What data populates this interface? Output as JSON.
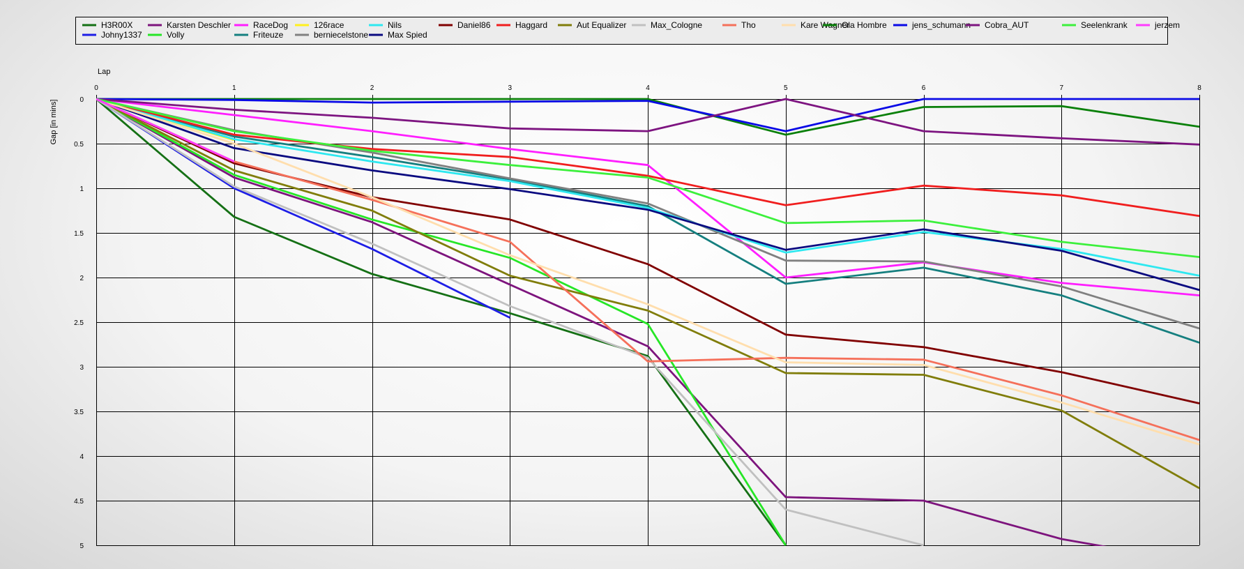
{
  "chart_data": {
    "type": "line",
    "xlabel": "Lap",
    "ylabel": "Gap [in mins]",
    "xlim": [
      0,
      8
    ],
    "ylim": [
      0,
      5
    ],
    "y_inverted": true,
    "grid": true,
    "legend_position": "top",
    "x_ticks": [
      "0",
      "1",
      "2",
      "3",
      "4",
      "5",
      "6",
      "7",
      "8"
    ],
    "y_ticks": [
      "0",
      "0.5",
      "1",
      "1.5",
      "2",
      "2.5",
      "3",
      "3.5",
      "4",
      "4.5",
      "5"
    ],
    "series": [
      {
        "name": "H3R00X",
        "color": "#157015",
        "x": [
          0,
          1,
          2,
          3,
          4,
          5
        ],
        "values": [
          0,
          1.32,
          1.96,
          2.4,
          2.88,
          5.0
        ]
      },
      {
        "name": "Johny1337",
        "color": "#1E1EE6",
        "x": [
          0,
          1,
          2,
          3
        ],
        "values": [
          0,
          1.0,
          1.68,
          2.45
        ]
      },
      {
        "name": "Karsten Deschler",
        "color": "#7D147D",
        "x": [
          0,
          1,
          2,
          3,
          4,
          5,
          6,
          7,
          8
        ],
        "values": [
          0,
          0.88,
          1.38,
          2.08,
          2.77,
          4.46,
          4.5,
          4.93,
          5.2
        ]
      },
      {
        "name": "Volly",
        "color": "#26E626",
        "x": [
          0,
          1,
          2,
          3,
          4,
          5
        ],
        "values": [
          0,
          0.85,
          1.35,
          1.78,
          2.52,
          5.0
        ]
      },
      {
        "name": "RaceDog",
        "color": "#FF1EFF",
        "x": [
          0,
          1,
          2,
          3,
          4,
          5,
          6,
          7,
          8
        ],
        "values": [
          0,
          0.18,
          0.36,
          0.56,
          0.74,
          2.0,
          1.83,
          2.06,
          2.2
        ]
      },
      {
        "name": "Friteuze",
        "color": "#157F7F",
        "x": [
          0,
          1,
          2,
          3,
          4,
          5,
          6,
          7,
          8
        ],
        "values": [
          0,
          0.42,
          0.65,
          0.9,
          1.2,
          2.07,
          1.89,
          2.2,
          2.73
        ]
      },
      {
        "name": "126race",
        "color": "#FFF01E",
        "x": [
          0,
          1
        ],
        "values": [
          0,
          0.46
        ]
      },
      {
        "name": "berniecelstone",
        "color": "#808080",
        "x": [
          0,
          1,
          2,
          3,
          4,
          5,
          6,
          7,
          8
        ],
        "values": [
          0,
          0.35,
          0.6,
          0.89,
          1.17,
          1.81,
          1.82,
          2.1,
          2.57
        ]
      },
      {
        "name": "Nils",
        "color": "#2EE8F0",
        "x": [
          0,
          1,
          2,
          3,
          4,
          5,
          6,
          7,
          8
        ],
        "values": [
          0,
          0.45,
          0.7,
          0.92,
          1.22,
          1.72,
          1.49,
          1.68,
          1.98
        ]
      },
      {
        "name": "Max Spied",
        "color": "#0A0A80",
        "x": [
          0,
          1,
          2,
          3,
          4,
          5,
          6,
          7,
          8
        ],
        "values": [
          0,
          0.55,
          0.8,
          1.01,
          1.24,
          1.69,
          1.46,
          1.7,
          2.14
        ]
      },
      {
        "name": "Daniel86",
        "color": "#800000",
        "x": [
          0,
          1,
          2,
          3,
          4,
          5,
          6,
          7,
          8
        ],
        "values": [
          0,
          0.72,
          1.1,
          1.35,
          1.85,
          2.64,
          2.78,
          3.06,
          3.41
        ]
      },
      {
        "name": "Haggard",
        "color": "#F01E1E",
        "x": [
          0,
          1,
          2,
          3,
          4,
          5,
          6,
          7,
          8
        ],
        "values": [
          0,
          0.4,
          0.56,
          0.65,
          0.86,
          1.19,
          0.97,
          1.08,
          1.31
        ]
      },
      {
        "name": "Aut Equalizer",
        "color": "#807D0A",
        "x": [
          0,
          1,
          2,
          3,
          4,
          5,
          6,
          7,
          8
        ],
        "values": [
          0,
          0.8,
          1.25,
          1.98,
          2.37,
          3.07,
          3.09,
          3.49,
          4.36
        ]
      },
      {
        "name": "Max_Cologne",
        "color": "#C0C0C0",
        "x": [
          0,
          1,
          2,
          3,
          4,
          5,
          6
        ],
        "values": [
          0,
          0.98,
          1.62,
          2.32,
          2.9,
          4.6,
          5.0
        ]
      },
      {
        "name": "Tho",
        "color": "#F5705A",
        "x": [
          0,
          1,
          2,
          3,
          4,
          5,
          6,
          7,
          8
        ],
        "values": [
          0,
          0.7,
          1.13,
          1.6,
          2.94,
          2.9,
          2.92,
          3.32,
          3.82
        ]
      },
      {
        "name": "Kare Wagner",
        "color": "#FFDEAD",
        "x": [
          0,
          1,
          2,
          3,
          4,
          5,
          6,
          7,
          8
        ],
        "values": [
          0,
          0.5,
          1.1,
          1.75,
          2.3,
          2.95,
          2.98,
          3.4,
          3.87
        ]
      },
      {
        "name": "Ola Hombre",
        "color": "#0A800A",
        "x": [
          0,
          1,
          2,
          3,
          4,
          5,
          6,
          7,
          8
        ],
        "values": [
          0,
          0.0,
          0.0,
          0.0,
          0.0,
          0.4,
          0.09,
          0.08,
          0.31
        ]
      },
      {
        "name": "jens_schumann",
        "color": "#0A0AE6",
        "x": [
          0,
          1,
          2,
          3,
          4,
          5,
          6,
          7,
          8
        ],
        "values": [
          0,
          0.01,
          0.04,
          0.03,
          0.02,
          0.36,
          0.0,
          0.0,
          0.0
        ]
      },
      {
        "name": "Cobra_AUT",
        "color": "#7D1480",
        "x": [
          0,
          1,
          2,
          3,
          4,
          5,
          6,
          7,
          8
        ],
        "values": [
          0,
          0.12,
          0.21,
          0.33,
          0.36,
          0.0,
          0.36,
          0.44,
          0.51
        ]
      },
      {
        "name": "Seelenkrank",
        "color": "#3CF03C",
        "x": [
          0,
          1,
          2,
          3,
          4,
          5,
          6,
          7,
          8
        ],
        "values": [
          0,
          0.36,
          0.58,
          0.74,
          0.88,
          1.39,
          1.36,
          1.6,
          1.77
        ]
      },
      {
        "name": "jerzem",
        "color": "#FF3CFF",
        "x": [
          0,
          1
        ],
        "values": [
          0,
          0.7
        ]
      }
    ]
  }
}
